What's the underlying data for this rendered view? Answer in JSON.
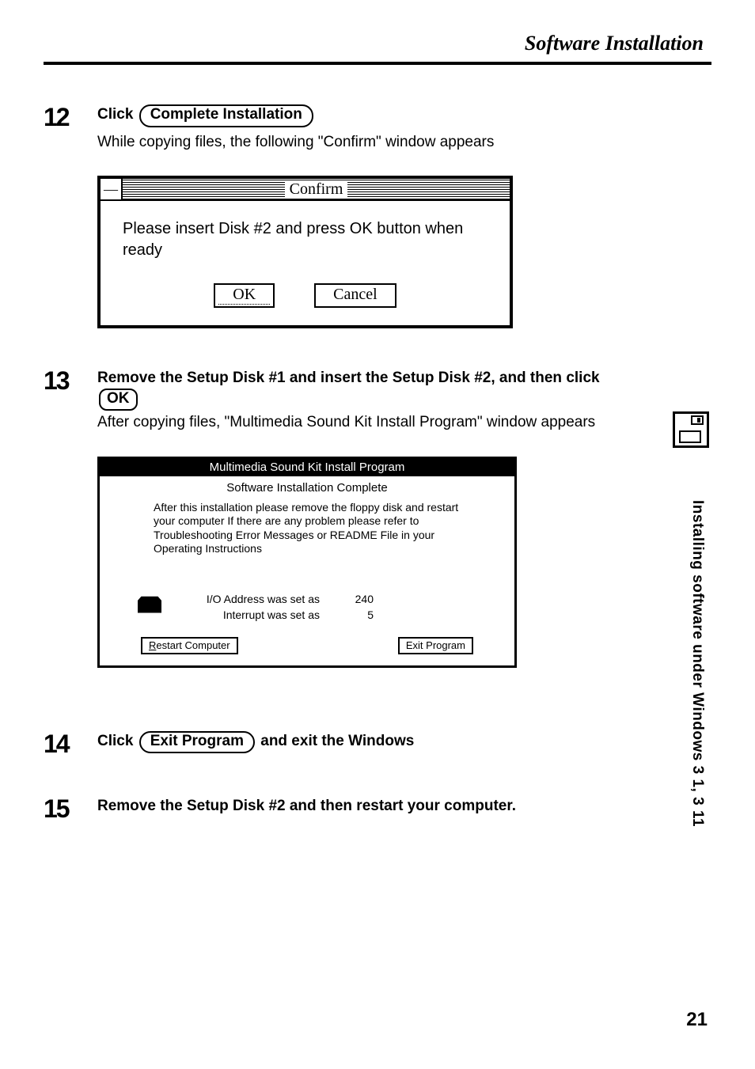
{
  "header": "Software Installation",
  "steps": {
    "s12": {
      "num": "12",
      "title_a": "Click",
      "btn": "Complete Installation",
      "desc": "While copying files, the following \"Confirm\" window appears"
    },
    "s13": {
      "num": "13",
      "title_a": "Remove the Setup Disk #1 and insert the Setup Disk #2, and then click",
      "btn": "OK",
      "desc": "After copying files, \"Multimedia Sound Kit Install Program\" window appears"
    },
    "s14": {
      "num": "14",
      "title_a": "Click",
      "btn": "Exit Program",
      "title_b": "and exit the Windows"
    },
    "s15": {
      "num": "15",
      "title": "Remove the Setup Disk #2 and then restart your computer."
    }
  },
  "confirm": {
    "sysmenu": "—",
    "title": "Confirm",
    "body": "Please insert Disk #2 and press OK button when ready",
    "ok": "OK",
    "cancel": "Cancel"
  },
  "install": {
    "title": "Multimedia Sound Kit Install Program",
    "subtitle": "Software Installation Complete",
    "body": "After this installation  please remove the floppy disk  and restart your computer    If there are any problem  please refer to  Troubleshooting   Error Messages  or  README File  in your Operating  Instructions",
    "io_label": "I/O Address was set as",
    "io_val": "240",
    "irq_label": "Interrupt was set as",
    "irq_val": "5",
    "restart": "Restart Computer",
    "exit": "Exit Program"
  },
  "side_text": "Installing software under Windows 3 1, 3 11",
  "page_num": "21"
}
